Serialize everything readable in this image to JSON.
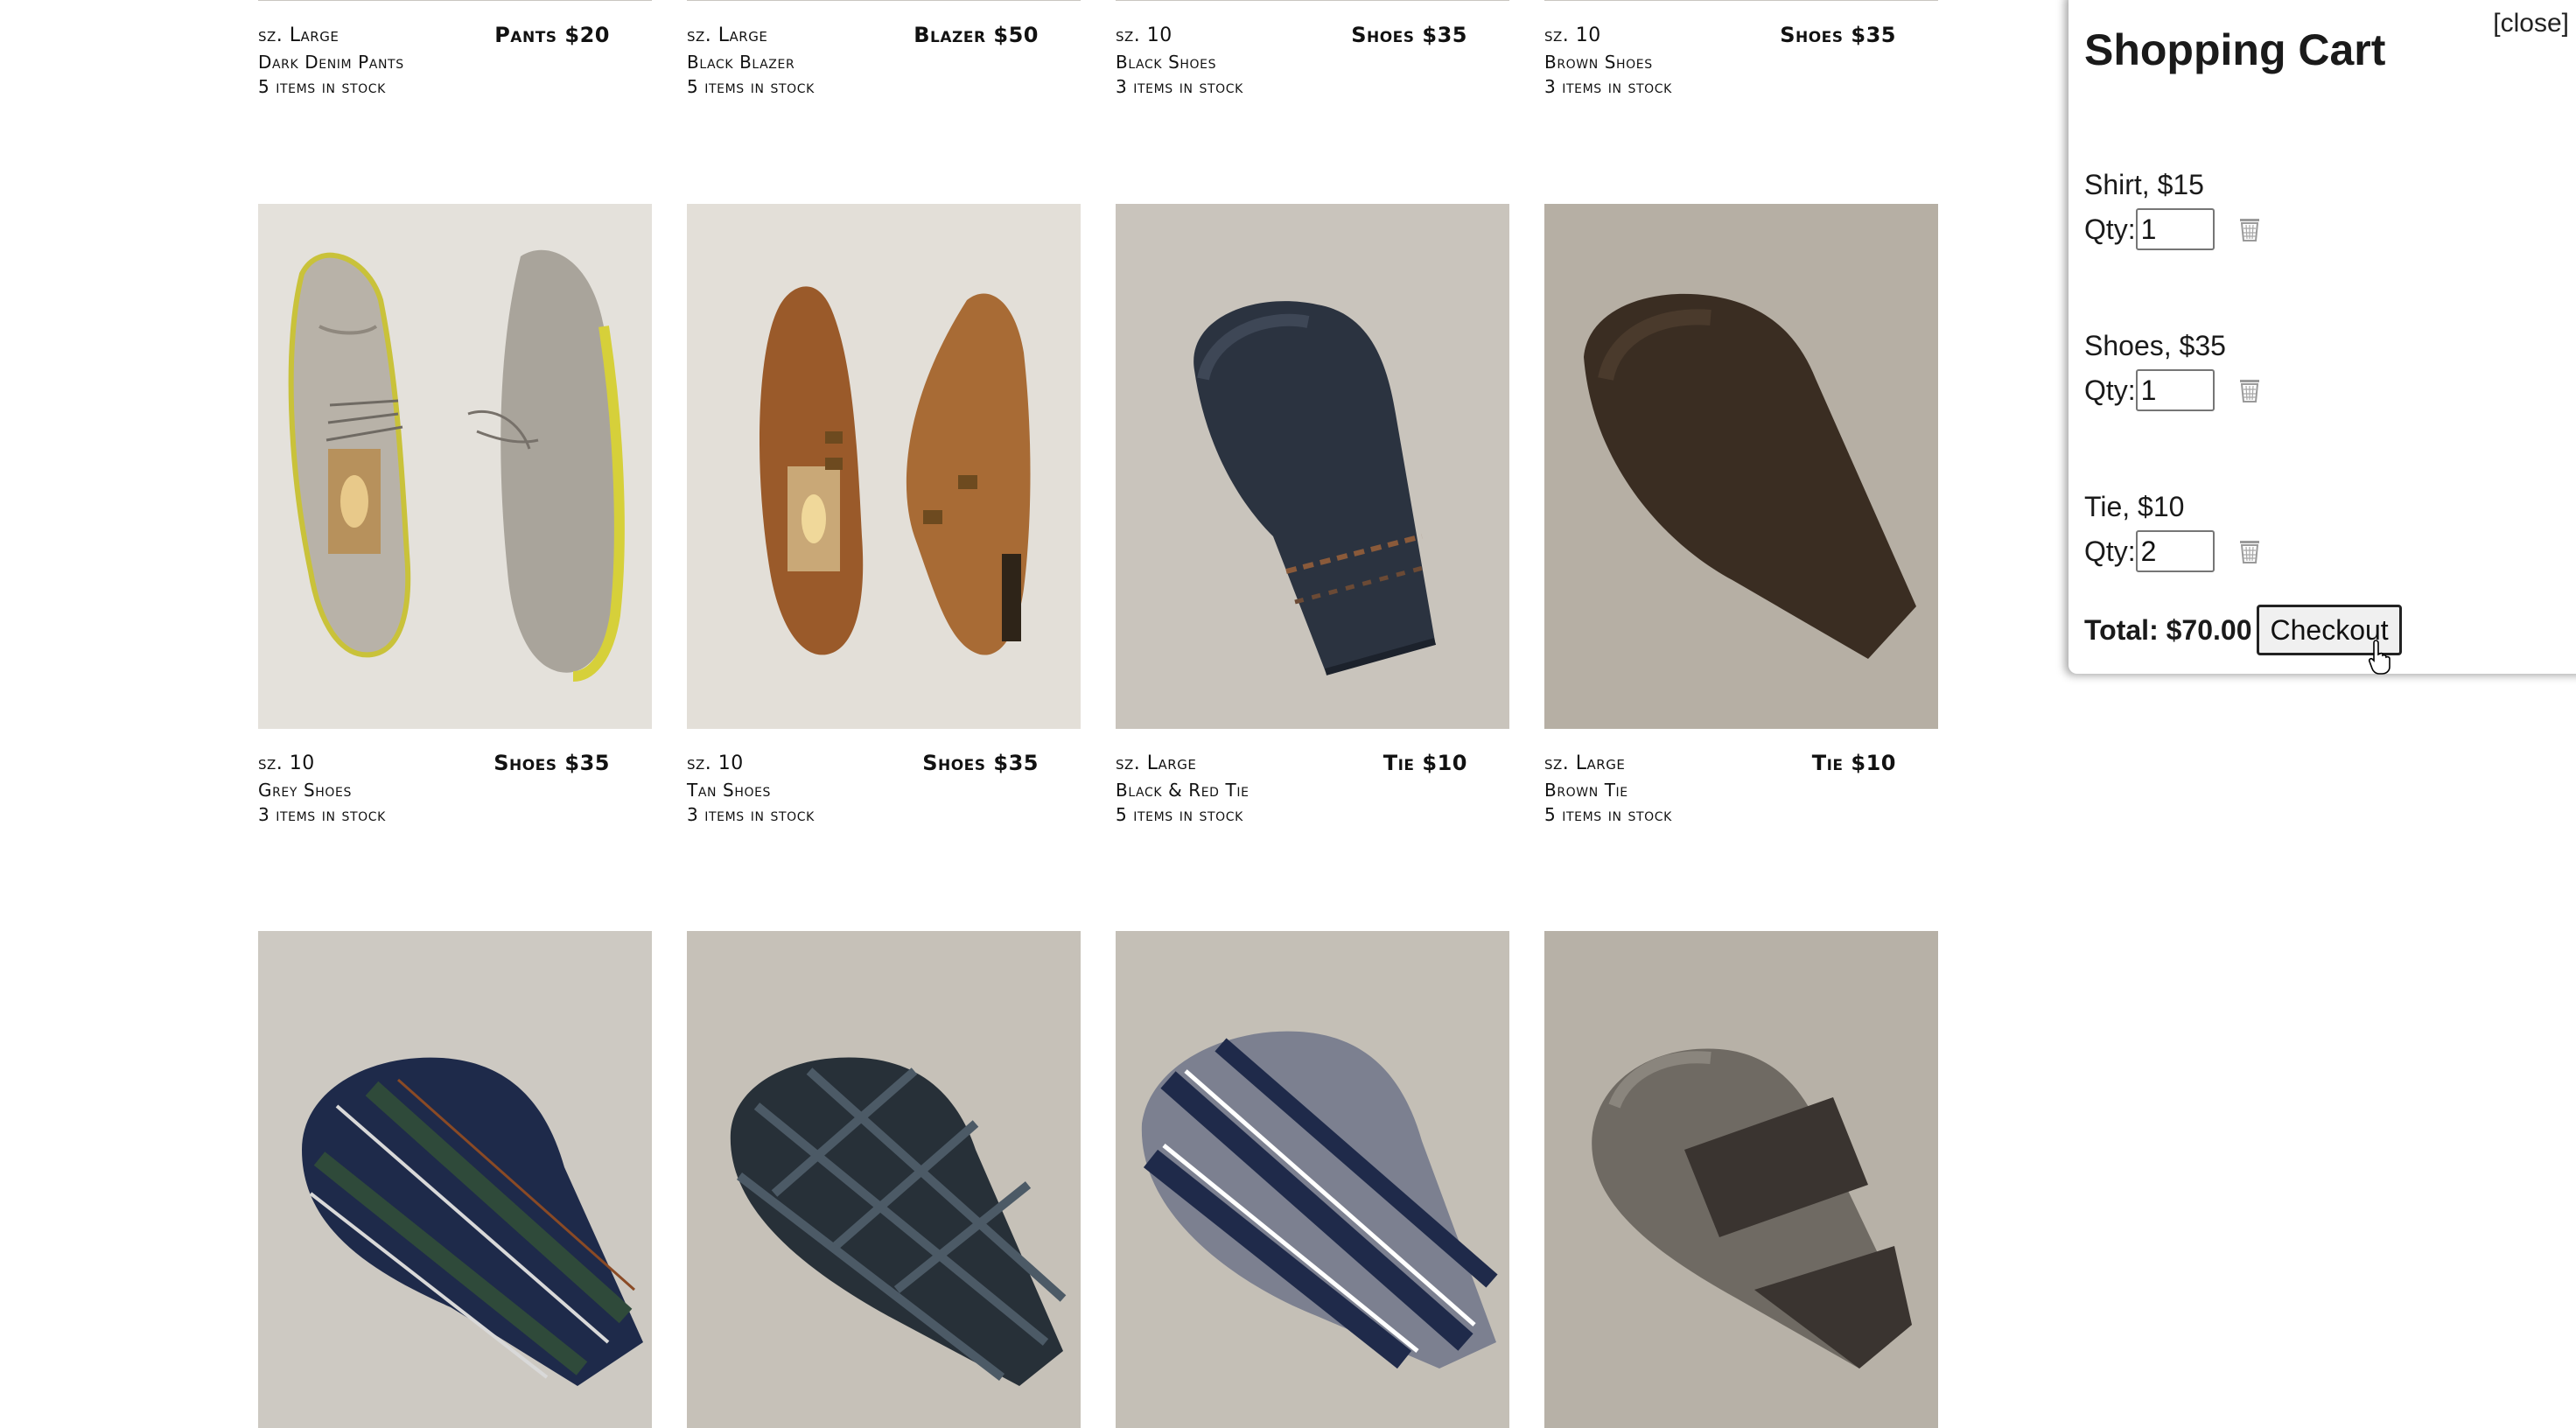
{
  "products_top_row": [
    {
      "size": "sz. Large",
      "name": "Dark Denim Pants",
      "stock": "5 items in stock",
      "price": "Pants $20"
    },
    {
      "size": "sz. Large",
      "name": "Black Blazer",
      "stock": "5 items in stock",
      "price": "Blazer $50"
    },
    {
      "size": "sz. 10",
      "name": "Black Shoes",
      "stock": "3 items in stock",
      "price": "Shoes $35"
    },
    {
      "size": "sz. 10",
      "name": "Brown Shoes",
      "stock": "3 items in stock",
      "price": "Shoes $35"
    }
  ],
  "products_middle_row": [
    {
      "size": "sz. 10",
      "name": "Grey Shoes",
      "stock": "3 items in stock",
      "price": "Shoes $35",
      "image": "grey-wingtip-shoes"
    },
    {
      "size": "sz. 10",
      "name": "Tan Shoes",
      "stock": "3 items in stock",
      "price": "Shoes $35",
      "image": "tan-monk-strap-shoes"
    },
    {
      "size": "sz. Large",
      "name": "Black & Red Tie",
      "stock": "5 items in stock",
      "price": "Tie $10",
      "image": "black-knit-tie"
    },
    {
      "size": "sz. Large",
      "name": "Brown Tie",
      "stock": "5 items in stock",
      "price": "Tie $10",
      "image": "brown-knit-tie"
    }
  ],
  "products_bottom_row": [
    {
      "image": "navy-green-striped-tie"
    },
    {
      "image": "grey-plaid-tie"
    },
    {
      "image": "navy-grey-striped-tie"
    },
    {
      "image": "grey-brown-knit-tie"
    }
  ],
  "cart": {
    "close_label": "[close]",
    "title": "Shopping Cart",
    "qty_label": "Qty:",
    "items": [
      {
        "label": "Shirt, $15",
        "qty": "1"
      },
      {
        "label": "Shoes, $35",
        "qty": "1"
      },
      {
        "label": "Tie, $10",
        "qty": "2"
      }
    ],
    "total": "Total: $70.00",
    "checkout_label": "Checkout",
    "trash_icon": "trash-icon"
  },
  "colors": {
    "photo_background": "#dcd9d2",
    "cart_shadow": "#000000"
  }
}
